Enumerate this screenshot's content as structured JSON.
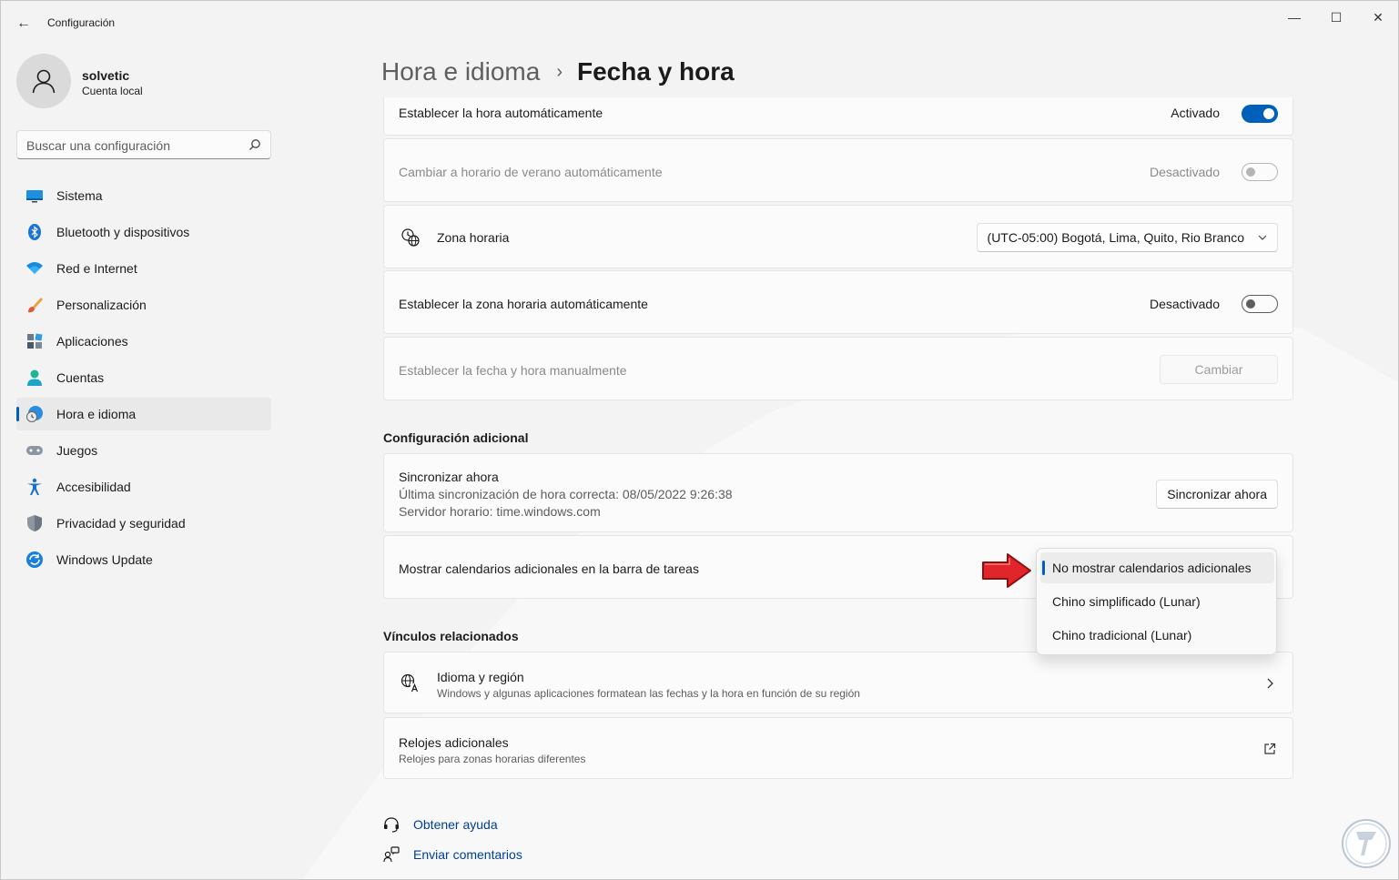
{
  "window": {
    "title": "Configuración",
    "back_label": "←",
    "minimize_label": "—",
    "maximize_label": "☐",
    "close_label": "✕"
  },
  "profile": {
    "name": "solvetic",
    "account_type": "Cuenta local"
  },
  "search": {
    "placeholder": "Buscar una configuración"
  },
  "sidebar": {
    "items": [
      {
        "label": "Sistema",
        "icon": "system-icon"
      },
      {
        "label": "Bluetooth y dispositivos",
        "icon": "bluetooth-icon"
      },
      {
        "label": "Red e Internet",
        "icon": "wifi-icon"
      },
      {
        "label": "Personalización",
        "icon": "brush-icon"
      },
      {
        "label": "Aplicaciones",
        "icon": "apps-icon"
      },
      {
        "label": "Cuentas",
        "icon": "person-icon"
      },
      {
        "label": "Hora e idioma",
        "icon": "clock-globe-icon",
        "selected": true
      },
      {
        "label": "Juegos",
        "icon": "gamepad-icon"
      },
      {
        "label": "Accesibilidad",
        "icon": "accessibility-icon"
      },
      {
        "label": "Privacidad y seguridad",
        "icon": "shield-icon"
      },
      {
        "label": "Windows Update",
        "icon": "update-icon"
      }
    ]
  },
  "header": {
    "parent": "Hora e idioma",
    "separator": "›",
    "current": "Fecha y hora"
  },
  "settings": {
    "auto_time": {
      "label": "Establecer la hora automáticamente",
      "state_text": "Activado",
      "on": true
    },
    "auto_dst": {
      "label": "Cambiar a horario de verano automáticamente",
      "state_text": "Desactivado",
      "on": false,
      "disabled": true
    },
    "timezone": {
      "label": "Zona horaria",
      "value": "(UTC-05:00) Bogotá, Lima, Quito, Rio Branco"
    },
    "auto_timezone": {
      "label": "Establecer la zona horaria automáticamente",
      "state_text": "Desactivado",
      "on": false
    },
    "manual_datetime": {
      "label": "Establecer la fecha y hora manualmente",
      "button": "Cambiar",
      "disabled": true
    }
  },
  "additional": {
    "title": "Configuración adicional",
    "sync": {
      "label": "Sincronizar ahora",
      "last_sync": "Última sincronización de hora correcta: 08/05/2022 9:26:38",
      "server": "Servidor horario: time.windows.com",
      "button": "Sincronizar ahora"
    },
    "calendars": {
      "label": "Mostrar calendarios adicionales en la barra de tareas",
      "options": [
        {
          "label": "No mostrar calendarios adicionales",
          "selected": true
        },
        {
          "label": "Chino simplificado (Lunar)",
          "selected": false
        },
        {
          "label": "Chino tradicional (Lunar)",
          "selected": false
        }
      ]
    }
  },
  "related": {
    "title": "Vínculos relacionados",
    "region": {
      "label": "Idioma y región",
      "description": "Windows y algunas aplicaciones formatean las fechas y la hora en función de su región"
    },
    "clocks": {
      "label": "Relojes adicionales",
      "description": "Relojes para zonas horarias diferentes"
    }
  },
  "help": {
    "get_help": "Obtener ayuda",
    "feedback": "Enviar comentarios"
  },
  "colors": {
    "accent": "#005fb8",
    "background": "#f3f3f3",
    "card": "#fbfbfb",
    "link": "#003e92",
    "annotation_arrow": "#e0262a"
  }
}
